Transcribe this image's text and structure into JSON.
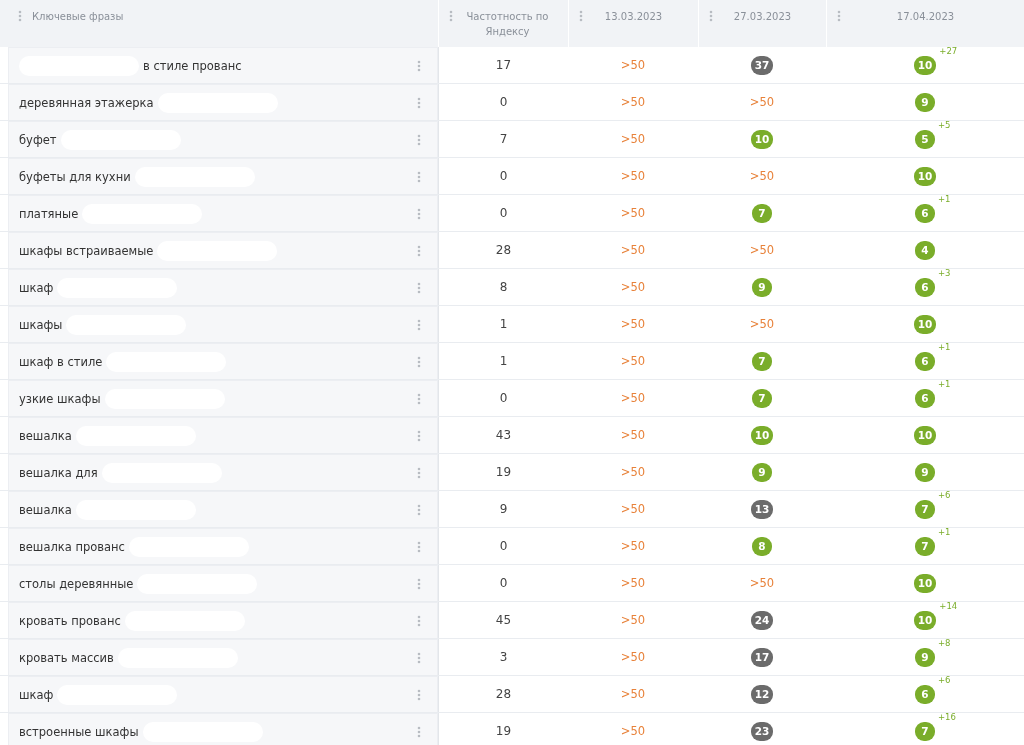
{
  "table": {
    "columns": [
      {
        "label": "Ключевые фразы"
      },
      {
        "label": "Частотность по Яндексу"
      },
      {
        "label": "13.03.2023"
      },
      {
        "label": "27.03.2023"
      },
      {
        "label": "17.04.2023"
      }
    ],
    "rows": [
      {
        "phrase": "в стиле прованс",
        "redacted_before": true,
        "redacted_after": false,
        "frequency": "17",
        "positions": [
          {
            "kind": "text",
            "text": ">50"
          },
          {
            "kind": "badge",
            "text": "37",
            "color": "#6b6b6b"
          },
          {
            "kind": "badge",
            "text": "10",
            "color": "#7aad2a",
            "delta": "+27"
          }
        ]
      },
      {
        "phrase": "деревянная этажерка",
        "redacted_before": false,
        "redacted_after": true,
        "frequency": "0",
        "positions": [
          {
            "kind": "text",
            "text": ">50"
          },
          {
            "kind": "text",
            "text": ">50"
          },
          {
            "kind": "badge",
            "text": "9",
            "color": "#7aad2a"
          }
        ]
      },
      {
        "phrase": "буфет",
        "redacted_before": false,
        "redacted_after": true,
        "frequency": "7",
        "positions": [
          {
            "kind": "text",
            "text": ">50"
          },
          {
            "kind": "badge",
            "text": "10",
            "color": "#7aad2a"
          },
          {
            "kind": "badge",
            "text": "5",
            "color": "#7aad2a",
            "delta": "+5"
          }
        ]
      },
      {
        "phrase": "буфеты для кухни",
        "redacted_before": false,
        "redacted_after": true,
        "frequency": "0",
        "positions": [
          {
            "kind": "text",
            "text": ">50"
          },
          {
            "kind": "text",
            "text": ">50"
          },
          {
            "kind": "badge",
            "text": "10",
            "color": "#7aad2a"
          }
        ]
      },
      {
        "phrase": "платяные",
        "redacted_before": false,
        "redacted_after": true,
        "frequency": "0",
        "positions": [
          {
            "kind": "text",
            "text": ">50"
          },
          {
            "kind": "badge",
            "text": "7",
            "color": "#7aad2a"
          },
          {
            "kind": "badge",
            "text": "6",
            "color": "#7aad2a",
            "delta": "+1"
          }
        ]
      },
      {
        "phrase": "шкафы встраиваемые",
        "redacted_before": false,
        "redacted_after": true,
        "frequency": "28",
        "positions": [
          {
            "kind": "text",
            "text": ">50"
          },
          {
            "kind": "text",
            "text": ">50"
          },
          {
            "kind": "badge",
            "text": "4",
            "color": "#7aad2a"
          }
        ]
      },
      {
        "phrase": "шкаф",
        "redacted_before": false,
        "redacted_after": true,
        "frequency": "8",
        "positions": [
          {
            "kind": "text",
            "text": ">50"
          },
          {
            "kind": "badge",
            "text": "9",
            "color": "#7aad2a"
          },
          {
            "kind": "badge",
            "text": "6",
            "color": "#7aad2a",
            "delta": "+3"
          }
        ]
      },
      {
        "phrase": "шкафы",
        "redacted_before": false,
        "redacted_after": true,
        "frequency": "1",
        "positions": [
          {
            "kind": "text",
            "text": ">50"
          },
          {
            "kind": "text",
            "text": ">50"
          },
          {
            "kind": "badge",
            "text": "10",
            "color": "#7aad2a"
          }
        ]
      },
      {
        "phrase": "шкаф в стиле",
        "redacted_before": false,
        "redacted_after": true,
        "frequency": "1",
        "positions": [
          {
            "kind": "text",
            "text": ">50"
          },
          {
            "kind": "badge",
            "text": "7",
            "color": "#7aad2a"
          },
          {
            "kind": "badge",
            "text": "6",
            "color": "#7aad2a",
            "delta": "+1"
          }
        ]
      },
      {
        "phrase": "узкие шкафы",
        "redacted_before": false,
        "redacted_after": true,
        "frequency": "0",
        "positions": [
          {
            "kind": "text",
            "text": ">50"
          },
          {
            "kind": "badge",
            "text": "7",
            "color": "#7aad2a"
          },
          {
            "kind": "badge",
            "text": "6",
            "color": "#7aad2a",
            "delta": "+1"
          }
        ]
      },
      {
        "phrase": "вешалка",
        "redacted_before": false,
        "redacted_after": true,
        "frequency": "43",
        "positions": [
          {
            "kind": "text",
            "text": ">50"
          },
          {
            "kind": "badge",
            "text": "10",
            "color": "#7aad2a"
          },
          {
            "kind": "badge",
            "text": "10",
            "color": "#7aad2a"
          }
        ]
      },
      {
        "phrase": "вешалка для",
        "redacted_before": false,
        "redacted_after": true,
        "frequency": "19",
        "positions": [
          {
            "kind": "text",
            "text": ">50"
          },
          {
            "kind": "badge",
            "text": "9",
            "color": "#7aad2a"
          },
          {
            "kind": "badge",
            "text": "9",
            "color": "#7aad2a"
          }
        ]
      },
      {
        "phrase": "вешалка",
        "redacted_before": false,
        "redacted_after": true,
        "frequency": "9",
        "positions": [
          {
            "kind": "text",
            "text": ">50"
          },
          {
            "kind": "badge",
            "text": "13",
            "color": "#6b6b6b"
          },
          {
            "kind": "badge",
            "text": "7",
            "color": "#7aad2a",
            "delta": "+6"
          }
        ]
      },
      {
        "phrase": "вешалка прованс",
        "redacted_before": false,
        "redacted_after": true,
        "frequency": "0",
        "positions": [
          {
            "kind": "text",
            "text": ">50"
          },
          {
            "kind": "badge",
            "text": "8",
            "color": "#7aad2a"
          },
          {
            "kind": "badge",
            "text": "7",
            "color": "#7aad2a",
            "delta": "+1"
          }
        ]
      },
      {
        "phrase": "столы деревянные",
        "redacted_before": false,
        "redacted_after": true,
        "frequency": "0",
        "positions": [
          {
            "kind": "text",
            "text": ">50"
          },
          {
            "kind": "text",
            "text": ">50"
          },
          {
            "kind": "badge",
            "text": "10",
            "color": "#7aad2a"
          }
        ]
      },
      {
        "phrase": "кровать прованс",
        "redacted_before": false,
        "redacted_after": true,
        "frequency": "45",
        "positions": [
          {
            "kind": "text",
            "text": ">50"
          },
          {
            "kind": "badge",
            "text": "24",
            "color": "#6b6b6b"
          },
          {
            "kind": "badge",
            "text": "10",
            "color": "#7aad2a",
            "delta": "+14"
          }
        ]
      },
      {
        "phrase": "кровать массив",
        "redacted_before": false,
        "redacted_after": true,
        "frequency": "3",
        "positions": [
          {
            "kind": "text",
            "text": ">50"
          },
          {
            "kind": "badge",
            "text": "17",
            "color": "#6b6b6b"
          },
          {
            "kind": "badge",
            "text": "9",
            "color": "#7aad2a",
            "delta": "+8"
          }
        ]
      },
      {
        "phrase": "шкаф",
        "redacted_before": false,
        "redacted_after": true,
        "frequency": "28",
        "positions": [
          {
            "kind": "text",
            "text": ">50"
          },
          {
            "kind": "badge",
            "text": "12",
            "color": "#6b6b6b"
          },
          {
            "kind": "badge",
            "text": "6",
            "color": "#7aad2a",
            "delta": "+6"
          }
        ]
      },
      {
        "phrase": "встроенные шкафы",
        "redacted_before": false,
        "redacted_after": true,
        "frequency": "19",
        "positions": [
          {
            "kind": "text",
            "text": ">50"
          },
          {
            "kind": "badge",
            "text": "23",
            "color": "#6b6b6b"
          },
          {
            "kind": "badge",
            "text": "7",
            "color": "#7aad2a",
            "delta": "+16"
          }
        ]
      }
    ]
  }
}
